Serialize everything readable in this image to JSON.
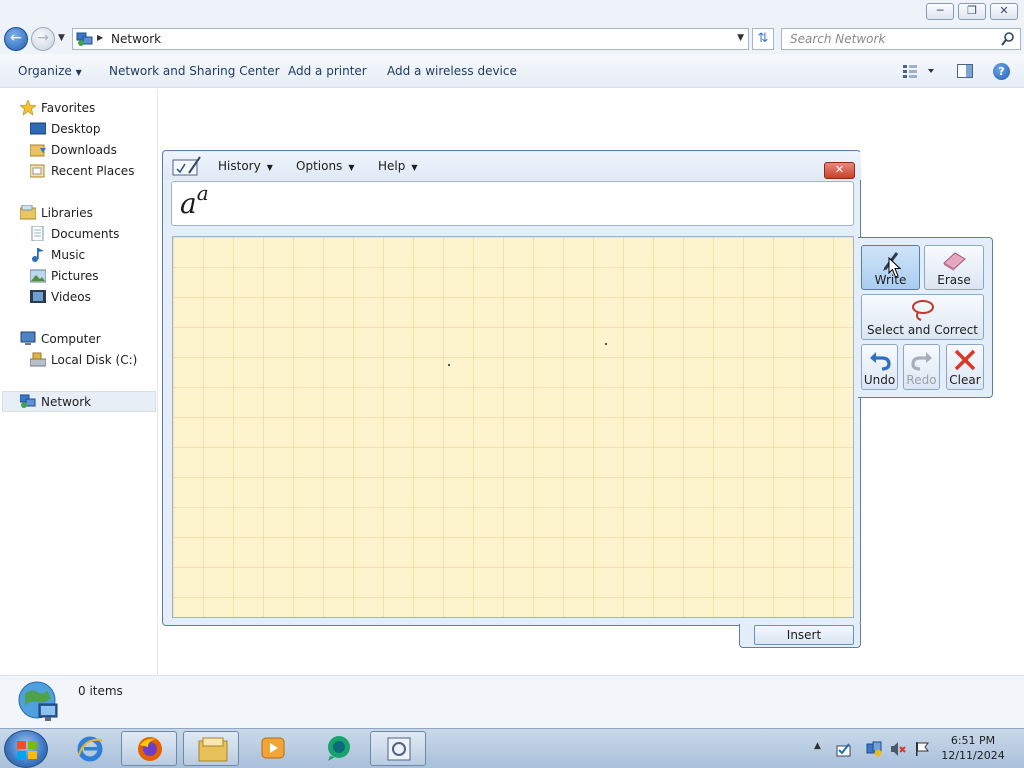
{
  "window": {
    "min_glyph": "─",
    "max_glyph": "❐",
    "close_glyph": "✕"
  },
  "address_bar": {
    "location": "Network",
    "search_placeholder": "Search Network"
  },
  "command_bar": {
    "organize": "Organize",
    "network_sharing_center": "Network and Sharing Center",
    "add_printer": "Add a printer",
    "add_wireless": "Add a wireless device"
  },
  "nav_pane": {
    "favorites": "Favorites",
    "desktop": "Desktop",
    "downloads": "Downloads",
    "recent_places": "Recent Places",
    "libraries": "Libraries",
    "documents": "Documents",
    "music": "Music",
    "pictures": "Pictures",
    "videos": "Videos",
    "computer": "Computer",
    "local_disk": "Local Disk (C:)",
    "network": "Network"
  },
  "details": {
    "item_count": "0 items"
  },
  "math_panel": {
    "menu_history": "History",
    "menu_options": "Options",
    "menu_help": "Help",
    "preview_base": "a",
    "preview_exponent": "a",
    "insert": "Insert",
    "tools": {
      "write": "Write",
      "erase": "Erase",
      "select_correct": "Select and Correct",
      "undo": "Undo",
      "redo": "Redo",
      "clear": "Clear"
    }
  },
  "taskbar": {
    "time": "6:51 PM",
    "date": "12/11/2024"
  },
  "colors": {
    "accent": "#3c76c2",
    "grid_bg": "#fdf4cd",
    "clear_red": "#d8392b"
  }
}
